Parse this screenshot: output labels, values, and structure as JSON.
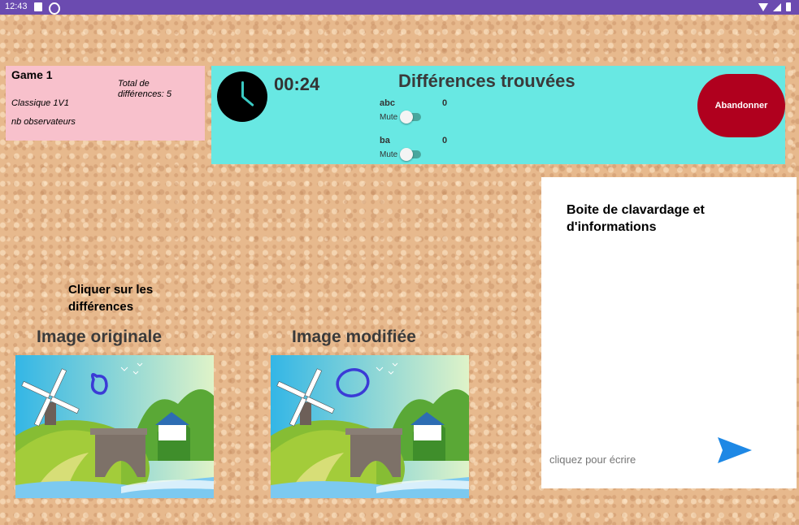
{
  "status_bar": {
    "time": "12:43"
  },
  "game_card": {
    "title": "Game 1",
    "mode": "Classique 1V1",
    "observers": "nb observateurs",
    "total_differences": "Total de différences: 5"
  },
  "top_bar": {
    "timer": "00:24",
    "title": "Différences trouvées",
    "players": [
      {
        "name": "abc",
        "score": "0",
        "mute_label": "Mute"
      },
      {
        "name": "ba",
        "score": "0",
        "mute_label": "Mute"
      }
    ],
    "quit_label": "Abandonner"
  },
  "instruction": "Cliquer sur les différences",
  "images": {
    "original_label": "Image originale",
    "modified_label": "Image modifiée"
  },
  "chat": {
    "title": "Boite de clavardage et d'informations",
    "placeholder": "cliquez pour écrire"
  },
  "colors": {
    "status_bar": "#6b4bb0",
    "game_card": "#f8c1cc",
    "top_bar": "#68e8e3",
    "quit_button": "#b0001e",
    "send_icon": "#1e88e5",
    "difference_marker": "#3b3bd6"
  }
}
